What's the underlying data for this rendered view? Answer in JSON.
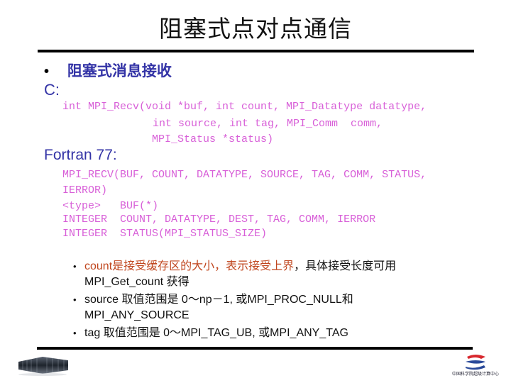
{
  "slide": {
    "title": "阻塞式点对点通信",
    "heading": {
      "bullet": "•",
      "text": "阻塞式消息接收"
    },
    "c_label": "C:",
    "c_code": [
      "int MPI_Recv(void *buf, int count, MPI_Datatype datatype,",
      "int source, int tag, MPI_Comm  comm,",
      "MPI_Status *status)"
    ],
    "fortran_label": "Fortran 77:",
    "fortran_code": [
      "MPI_RECV(BUF, COUNT, DATATYPE, SOURCE, TAG, COMM, STATUS,",
      "IERROR)",
      "<type>   BUF(*)",
      "INTEGER  COUNT, DATATYPE, DEST, TAG, COMM, IERROR",
      "INTEGER  STATUS(MPI_STATUS_SIZE)"
    ],
    "notes": [
      {
        "bullet": "•",
        "highlight": "count是接受缓存区的大小，表示接受上界",
        "text": "，具体接受长度可用 MPI_Get_count 获得"
      },
      {
        "bullet": "•",
        "highlight": "",
        "text": "source 取值范围是 0～np－1,   或MPI_PROC_NULL和 MPI_ANY_SOURCE"
      },
      {
        "bullet": "•",
        "highlight": "",
        "text": "tag 取值范围是 0～MPI_TAG_UB,   或MPI_ANY_TAG"
      }
    ],
    "logo_text": "中国科学院超级计算中心",
    "icons": {
      "left_image": "supercomputer-racks-image",
      "logo": "institution-logo"
    },
    "colors": {
      "heading_blue": "#3333a6",
      "code_magenta": "#d860d8",
      "highlight_red": "#c0461e"
    }
  }
}
